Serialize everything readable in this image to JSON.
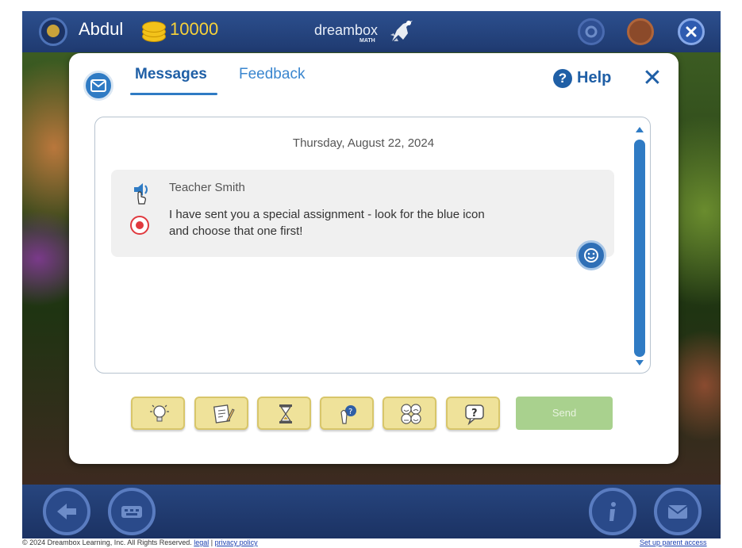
{
  "header": {
    "username": "Abdul",
    "coins": "10000",
    "brand": "dreambox",
    "brand_sub": "MATH"
  },
  "modal": {
    "tabs": [
      {
        "label": "Messages",
        "active": true
      },
      {
        "label": "Feedback",
        "active": false
      }
    ],
    "help_label": "Help",
    "close_glyph": "✕",
    "date": "Thursday, August 22, 2024",
    "message": {
      "sender": "Teacher Smith",
      "text": "I have sent you a special assignment - look for the blue icon and choose that one first!"
    },
    "stickers": [
      "lightbulb-icon",
      "notepad-pencil-icon",
      "hourglass-icon",
      "question-thinking-icon",
      "emoji-faces-icon",
      "question-bubble-icon"
    ],
    "send_label": "Send"
  },
  "footer": {
    "copyright": "© 2024 Dreambox Learning, Inc. All Rights Reserved.",
    "legal": "legal",
    "separator": "|",
    "privacy": "privacy policy",
    "parent_access": "Set up parent access"
  },
  "colors": {
    "topbar": "#2c4f8e",
    "accent_blue": "#1f5fa6",
    "coin_yellow": "#f7d23a",
    "sticker_bg": "#efe29a",
    "send_disabled": "#a9d18e",
    "record_red": "#e0393e"
  }
}
